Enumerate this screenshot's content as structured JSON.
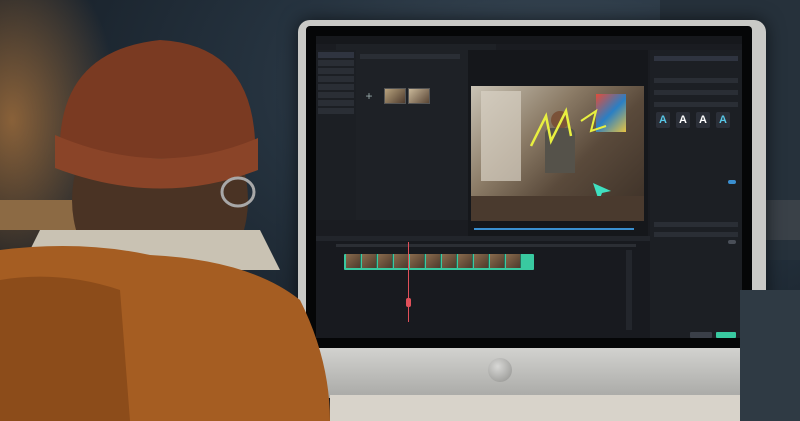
{
  "scene": {
    "description_free": true,
    "colors": {
      "accent": "#3fe0c0",
      "timeline_clip": "#39c9a0",
      "text_tile": "#58c8e8"
    }
  },
  "editor": {
    "media_panel": {
      "items": [
        "",
        "",
        "",
        "",
        "",
        "",
        "",
        "",
        "",
        ""
      ],
      "import_label": ""
    },
    "text_tiles": [
      "A",
      "A",
      "A",
      "A"
    ],
    "icons": [
      "plus-icon",
      "cursor-icon",
      "playhead-icon"
    ]
  }
}
